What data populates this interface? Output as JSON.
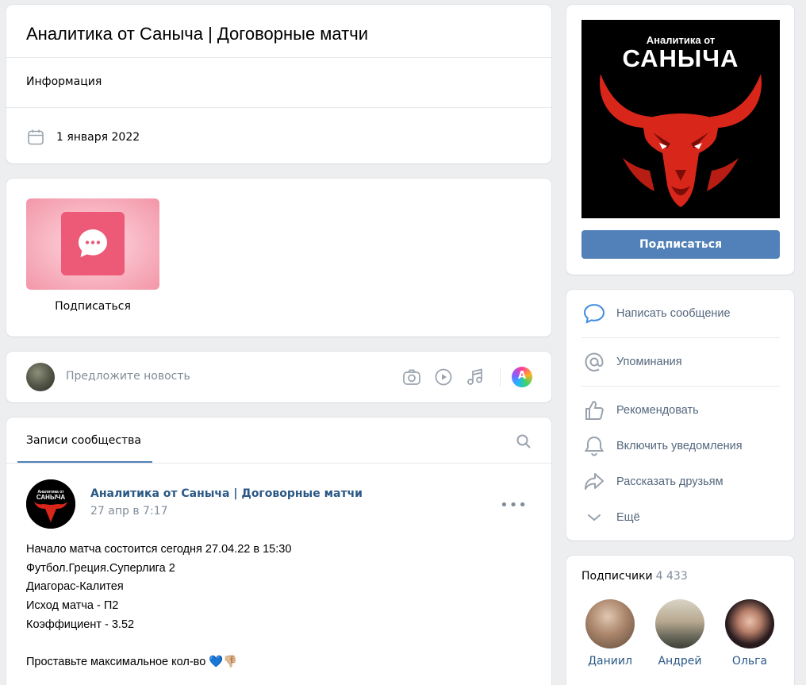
{
  "community": {
    "title": "Аналитика от Саныча | Договорные матчи",
    "info_tab": "Информация",
    "date": "1 января 2022"
  },
  "chat_widget": {
    "label": "Подписаться"
  },
  "suggest": {
    "placeholder": "Предложите новость",
    "icons": [
      "camera-icon",
      "video-icon",
      "music-icon",
      "avatar-ai-icon"
    ],
    "ai_letter": "A"
  },
  "posts": {
    "tab_label": "Записи сообщества",
    "post": {
      "author": "Аналитика от Саныча | Договорные матчи",
      "time": "27 апр в 7:17",
      "more": "•••",
      "lines": [
        "Начало матча состоится сегодня 27.04.22 в 15:30",
        "Футбол.Греция.Суперлига 2",
        "Диагорас-Калитея",
        "Исход матча - П2",
        "Коэффициент - 3.52"
      ],
      "footer": "Проставьте максимальное кол-во 💙👎🏼"
    }
  },
  "cover": {
    "line1": "Аналитика от",
    "line2": "САНЫЧА",
    "subscribe_label": "Подписаться",
    "accent": "#5181b8"
  },
  "actions": [
    {
      "label": "Написать сообщение",
      "icon": "message-icon"
    },
    {
      "label": "Упоминания",
      "icon": "at-icon"
    },
    {
      "label": "Рекомендовать",
      "icon": "thumbs-up-icon"
    },
    {
      "label": "Включить уведомления",
      "icon": "bell-icon"
    },
    {
      "label": "Рассказать друзьям",
      "icon": "share-icon"
    },
    {
      "label": "Ещё",
      "icon": "chevron-down-icon"
    }
  ],
  "subscribers": {
    "label": "Подписчики",
    "count": "4 433",
    "people": [
      {
        "name": "Даниил"
      },
      {
        "name": "Андрей"
      },
      {
        "name": "Ольга"
      }
    ]
  }
}
